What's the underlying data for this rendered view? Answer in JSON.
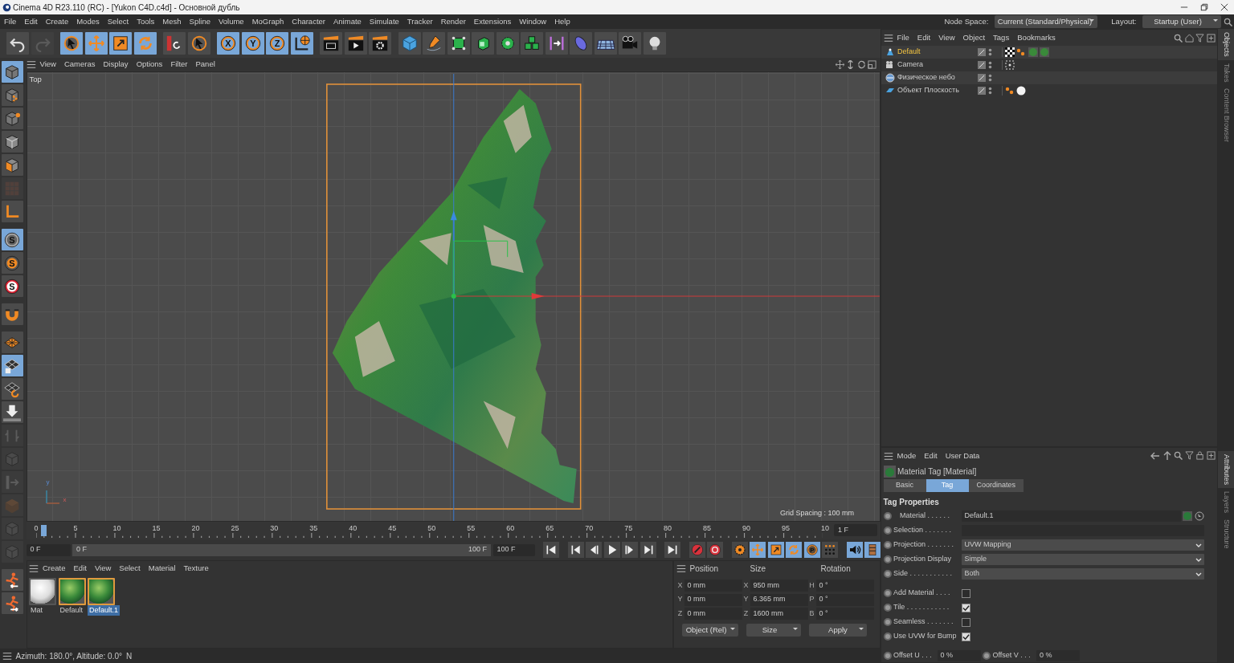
{
  "window": {
    "title": "Cinema 4D R23.110 (RC) - [Yukon C4D.c4d] - Основной дубль"
  },
  "menu": [
    "File",
    "Edit",
    "Create",
    "Modes",
    "Select",
    "Tools",
    "Mesh",
    "Spline",
    "Volume",
    "MoGraph",
    "Character",
    "Animate",
    "Simulate",
    "Tracker",
    "Render",
    "Extensions",
    "Window",
    "Help"
  ],
  "node_space": {
    "label": "Node Space:",
    "value": "Current (Standard/Physical)"
  },
  "layout": {
    "label": "Layout:",
    "value": "Startup (User)"
  },
  "toolbar": [
    {
      "selected": false,
      "disabled": false
    },
    {
      "selected": false,
      "disabled": true
    },
    {
      "selected": true,
      "disabled": false
    },
    {
      "selected": true,
      "disabled": false
    },
    {
      "selected": true,
      "disabled": false
    },
    {
      "selected": true,
      "disabled": false
    },
    {
      "selected": false,
      "disabled": false
    },
    {
      "selected": false,
      "disabled": false
    },
    {
      "selected": true,
      "disabled": false,
      "glyph": "X"
    },
    {
      "selected": true,
      "disabled": false,
      "glyph": "Y"
    },
    {
      "selected": true,
      "disabled": false,
      "glyph": "Z"
    },
    {
      "selected": true,
      "disabled": false
    },
    {
      "selected": false,
      "disabled": false
    },
    {
      "selected": false,
      "disabled": false
    },
    {
      "selected": false,
      "disabled": false
    },
    {
      "selected": false,
      "disabled": false
    },
    {
      "selected": false,
      "disabled": false
    },
    {
      "selected": false,
      "disabled": false
    },
    {
      "selected": false,
      "disabled": false
    },
    {
      "selected": false,
      "disabled": false
    },
    {
      "selected": false,
      "disabled": false
    },
    {
      "selected": false,
      "disabled": false
    },
    {
      "selected": false,
      "disabled": false
    },
    {
      "selected": false,
      "disabled": false
    },
    {
      "selected": false,
      "disabled": false
    },
    {
      "selected": false,
      "disabled": false
    }
  ],
  "left_tools": [
    {
      "selected": true,
      "disabled": false
    },
    {
      "selected": false,
      "disabled": false
    },
    {
      "selected": false,
      "disabled": false
    },
    {
      "selected": false,
      "disabled": false
    },
    {
      "selected": false,
      "disabled": false
    },
    {
      "selected": false,
      "disabled": true
    },
    {
      "selected": false,
      "disabled": false
    },
    {
      "selected": true,
      "disabled": false,
      "glyph": "S"
    },
    {
      "selected": false,
      "disabled": false,
      "glyph": "S"
    },
    {
      "selected": false,
      "disabled": false,
      "glyph": "S"
    },
    {
      "selected": false,
      "disabled": false
    },
    {
      "selected": false,
      "disabled": false
    },
    {
      "selected": true,
      "disabled": false
    },
    {
      "selected": false,
      "disabled": false
    },
    {
      "selected": false,
      "disabled": false
    },
    {
      "selected": false,
      "disabled": true
    },
    {
      "selected": false,
      "disabled": true
    },
    {
      "selected": false,
      "disabled": true
    },
    {
      "selected": false,
      "disabled": true
    },
    {
      "selected": false,
      "disabled": true
    },
    {
      "selected": false,
      "disabled": true
    },
    {
      "selected": false,
      "disabled": false
    },
    {
      "selected": false,
      "disabled": false
    }
  ],
  "viewport": {
    "menu": [
      "View",
      "Cameras",
      "Display",
      "Options",
      "Filter",
      "Panel"
    ],
    "camera": "Top",
    "grid_spacing": "Grid Spacing : 100 mm",
    "axis_labels": [
      "y",
      "x"
    ]
  },
  "timeline": {
    "ticks": [
      "0",
      "5",
      "10",
      "15",
      "20",
      "25",
      "30",
      "35",
      "40",
      "45",
      "50",
      "55",
      "60",
      "65",
      "70",
      "75",
      "80",
      "85",
      "90",
      "95",
      "10"
    ],
    "current_frame": "1 F",
    "start": "0 F",
    "range_start": "0 F",
    "range_end": "100 F",
    "end": "100 F",
    "level": 1
  },
  "transport": [
    {
      "selected": false
    },
    {
      "selected": false
    },
    {
      "selected": false
    },
    {
      "selected": false
    },
    {
      "selected": false
    },
    {
      "selected": false
    },
    {
      "selected": false
    },
    {
      "selected": false
    },
    {
      "selected": false
    },
    {
      "selected": false
    },
    {
      "selected": true
    },
    {
      "selected": true
    },
    {
      "selected": true
    },
    {
      "selected": true,
      "glyph": "P"
    },
    {
      "selected": false
    },
    {
      "selected": true
    },
    {
      "selected": true
    }
  ],
  "materials": {
    "menu": [
      "Create",
      "Edit",
      "View",
      "Select",
      "Material",
      "Texture"
    ],
    "items": [
      {
        "name": "Mat",
        "kind": "plain",
        "selected": false,
        "in_use": false
      },
      {
        "name": "Default",
        "kind": "terrain",
        "selected": false,
        "in_use": true
      },
      {
        "name": "Default.1",
        "kind": "terrain",
        "selected": true,
        "in_use": true
      }
    ]
  },
  "coordinates": {
    "headers": [
      "Position",
      "Size",
      "Rotation"
    ],
    "rows": [
      {
        "axis": "X",
        "position": "0 mm",
        "size_axis": "X",
        "size": "950 mm",
        "rotation_axis": "H",
        "rotation": "0 °"
      },
      {
        "axis": "Y",
        "position": "0 mm",
        "size_axis": "Y",
        "size": "6.365 mm",
        "rotation_axis": "P",
        "rotation": "0 °"
      },
      {
        "axis": "Z",
        "position": "0 mm",
        "size_axis": "Z",
        "size": "1600 mm",
        "rotation_axis": "B",
        "rotation": "0 °"
      }
    ],
    "mode": "Object (Rel)",
    "size_mode": "Size",
    "apply": "Apply"
  },
  "status_bar": {
    "text": "Azimuth: 180.0°, Altitude: 0.0°",
    "direction": "N"
  },
  "objects": {
    "menu": [
      "File",
      "Edit",
      "View",
      "Object",
      "Tags",
      "Bookmarks"
    ],
    "items": [
      {
        "name": "Default",
        "kind": "figure",
        "selected": true
      },
      {
        "name": "Camera",
        "kind": "camera",
        "selected": false
      },
      {
        "name": "Физическое небо",
        "kind": "sky",
        "selected": false
      },
      {
        "name": "Объект Плоскость",
        "kind": "plane",
        "selected": false
      }
    ]
  },
  "attributes": {
    "menu": [
      "Mode",
      "Edit",
      "User Data"
    ],
    "title": "Material Tag [Material]",
    "tabs": [
      {
        "label": "Basic",
        "selected": false
      },
      {
        "label": "Tag",
        "selected": true
      },
      {
        "label": "Coordinates",
        "selected": false
      }
    ],
    "section": "Tag Properties",
    "fields": [
      {
        "kind": "link",
        "label": "Material . . . . . .",
        "value": "Default.1",
        "keyed": false
      },
      {
        "kind": "text",
        "label": "Selection . . . . . . .",
        "keyed": false
      },
      {
        "kind": "dropdown",
        "label": "Projection . . . . . . .",
        "value": "UVW Mapping",
        "keyed": false
      },
      {
        "kind": "dropdown",
        "label": "Projection Display",
        "value": "Simple",
        "keyed": false
      },
      {
        "kind": "dropdown",
        "label": "Side . . . . . . . . . . .",
        "value": "Both",
        "keyed": false
      },
      {
        "kind": "checkbox",
        "label": "Add Material . . . .",
        "checked": false,
        "keyed": false
      },
      {
        "kind": "checkbox",
        "label": "Tile . . . . . . . . . . .",
        "checked": true,
        "keyed": false
      },
      {
        "kind": "checkbox",
        "label": "Seamless . . . . . . .",
        "checked": false,
        "keyed": false
      },
      {
        "kind": "checkbox",
        "label": "Use UVW for Bump",
        "checked": true,
        "keyed": false
      },
      {
        "kind": "pair",
        "label": "Offset U . . .",
        "value": "0 %",
        "label2": "Offset V . . .",
        "value2": "0 %",
        "keyed": false,
        "keyed2": false
      }
    ]
  },
  "side_tabs": {
    "top": [
      {
        "label": "Objects",
        "selected": true
      },
      {
        "label": "Takes",
        "selected": false
      },
      {
        "label": "Content Browser",
        "selected": false
      }
    ],
    "bottom": [
      {
        "label": "Attributes",
        "selected": true
      },
      {
        "label": "Layers",
        "selected": false
      },
      {
        "label": "Structure",
        "selected": false
      }
    ]
  }
}
